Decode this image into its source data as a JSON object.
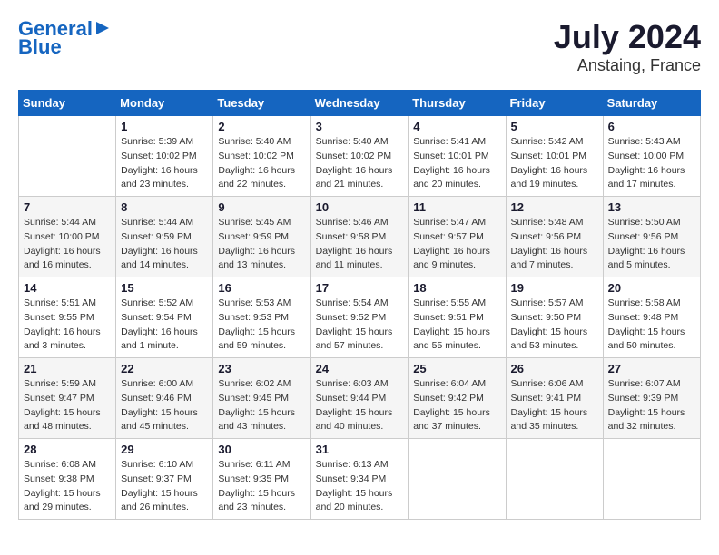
{
  "header": {
    "logo_line1": "General",
    "logo_line2": "Blue",
    "title": "July 2024",
    "subtitle": "Anstaing, France"
  },
  "weekdays": [
    "Sunday",
    "Monday",
    "Tuesday",
    "Wednesday",
    "Thursday",
    "Friday",
    "Saturday"
  ],
  "weeks": [
    [
      {
        "day": "",
        "sunrise": "",
        "sunset": "",
        "daylight": ""
      },
      {
        "day": "1",
        "sunrise": "Sunrise: 5:39 AM",
        "sunset": "Sunset: 10:02 PM",
        "daylight": "Daylight: 16 hours and 23 minutes."
      },
      {
        "day": "2",
        "sunrise": "Sunrise: 5:40 AM",
        "sunset": "Sunset: 10:02 PM",
        "daylight": "Daylight: 16 hours and 22 minutes."
      },
      {
        "day": "3",
        "sunrise": "Sunrise: 5:40 AM",
        "sunset": "Sunset: 10:02 PM",
        "daylight": "Daylight: 16 hours and 21 minutes."
      },
      {
        "day": "4",
        "sunrise": "Sunrise: 5:41 AM",
        "sunset": "Sunset: 10:01 PM",
        "daylight": "Daylight: 16 hours and 20 minutes."
      },
      {
        "day": "5",
        "sunrise": "Sunrise: 5:42 AM",
        "sunset": "Sunset: 10:01 PM",
        "daylight": "Daylight: 16 hours and 19 minutes."
      },
      {
        "day": "6",
        "sunrise": "Sunrise: 5:43 AM",
        "sunset": "Sunset: 10:00 PM",
        "daylight": "Daylight: 16 hours and 17 minutes."
      }
    ],
    [
      {
        "day": "7",
        "sunrise": "Sunrise: 5:44 AM",
        "sunset": "Sunset: 10:00 PM",
        "daylight": "Daylight: 16 hours and 16 minutes."
      },
      {
        "day": "8",
        "sunrise": "Sunrise: 5:44 AM",
        "sunset": "Sunset: 9:59 PM",
        "daylight": "Daylight: 16 hours and 14 minutes."
      },
      {
        "day": "9",
        "sunrise": "Sunrise: 5:45 AM",
        "sunset": "Sunset: 9:59 PM",
        "daylight": "Daylight: 16 hours and 13 minutes."
      },
      {
        "day": "10",
        "sunrise": "Sunrise: 5:46 AM",
        "sunset": "Sunset: 9:58 PM",
        "daylight": "Daylight: 16 hours and 11 minutes."
      },
      {
        "day": "11",
        "sunrise": "Sunrise: 5:47 AM",
        "sunset": "Sunset: 9:57 PM",
        "daylight": "Daylight: 16 hours and 9 minutes."
      },
      {
        "day": "12",
        "sunrise": "Sunrise: 5:48 AM",
        "sunset": "Sunset: 9:56 PM",
        "daylight": "Daylight: 16 hours and 7 minutes."
      },
      {
        "day": "13",
        "sunrise": "Sunrise: 5:50 AM",
        "sunset": "Sunset: 9:56 PM",
        "daylight": "Daylight: 16 hours and 5 minutes."
      }
    ],
    [
      {
        "day": "14",
        "sunrise": "Sunrise: 5:51 AM",
        "sunset": "Sunset: 9:55 PM",
        "daylight": "Daylight: 16 hours and 3 minutes."
      },
      {
        "day": "15",
        "sunrise": "Sunrise: 5:52 AM",
        "sunset": "Sunset: 9:54 PM",
        "daylight": "Daylight: 16 hours and 1 minute."
      },
      {
        "day": "16",
        "sunrise": "Sunrise: 5:53 AM",
        "sunset": "Sunset: 9:53 PM",
        "daylight": "Daylight: 15 hours and 59 minutes."
      },
      {
        "day": "17",
        "sunrise": "Sunrise: 5:54 AM",
        "sunset": "Sunset: 9:52 PM",
        "daylight": "Daylight: 15 hours and 57 minutes."
      },
      {
        "day": "18",
        "sunrise": "Sunrise: 5:55 AM",
        "sunset": "Sunset: 9:51 PM",
        "daylight": "Daylight: 15 hours and 55 minutes."
      },
      {
        "day": "19",
        "sunrise": "Sunrise: 5:57 AM",
        "sunset": "Sunset: 9:50 PM",
        "daylight": "Daylight: 15 hours and 53 minutes."
      },
      {
        "day": "20",
        "sunrise": "Sunrise: 5:58 AM",
        "sunset": "Sunset: 9:48 PM",
        "daylight": "Daylight: 15 hours and 50 minutes."
      }
    ],
    [
      {
        "day": "21",
        "sunrise": "Sunrise: 5:59 AM",
        "sunset": "Sunset: 9:47 PM",
        "daylight": "Daylight: 15 hours and 48 minutes."
      },
      {
        "day": "22",
        "sunrise": "Sunrise: 6:00 AM",
        "sunset": "Sunset: 9:46 PM",
        "daylight": "Daylight: 15 hours and 45 minutes."
      },
      {
        "day": "23",
        "sunrise": "Sunrise: 6:02 AM",
        "sunset": "Sunset: 9:45 PM",
        "daylight": "Daylight: 15 hours and 43 minutes."
      },
      {
        "day": "24",
        "sunrise": "Sunrise: 6:03 AM",
        "sunset": "Sunset: 9:44 PM",
        "daylight": "Daylight: 15 hours and 40 minutes."
      },
      {
        "day": "25",
        "sunrise": "Sunrise: 6:04 AM",
        "sunset": "Sunset: 9:42 PM",
        "daylight": "Daylight: 15 hours and 37 minutes."
      },
      {
        "day": "26",
        "sunrise": "Sunrise: 6:06 AM",
        "sunset": "Sunset: 9:41 PM",
        "daylight": "Daylight: 15 hours and 35 minutes."
      },
      {
        "day": "27",
        "sunrise": "Sunrise: 6:07 AM",
        "sunset": "Sunset: 9:39 PM",
        "daylight": "Daylight: 15 hours and 32 minutes."
      }
    ],
    [
      {
        "day": "28",
        "sunrise": "Sunrise: 6:08 AM",
        "sunset": "Sunset: 9:38 PM",
        "daylight": "Daylight: 15 hours and 29 minutes."
      },
      {
        "day": "29",
        "sunrise": "Sunrise: 6:10 AM",
        "sunset": "Sunset: 9:37 PM",
        "daylight": "Daylight: 15 hours and 26 minutes."
      },
      {
        "day": "30",
        "sunrise": "Sunrise: 6:11 AM",
        "sunset": "Sunset: 9:35 PM",
        "daylight": "Daylight: 15 hours and 23 minutes."
      },
      {
        "day": "31",
        "sunrise": "Sunrise: 6:13 AM",
        "sunset": "Sunset: 9:34 PM",
        "daylight": "Daylight: 15 hours and 20 minutes."
      },
      {
        "day": "",
        "sunrise": "",
        "sunset": "",
        "daylight": ""
      },
      {
        "day": "",
        "sunrise": "",
        "sunset": "",
        "daylight": ""
      },
      {
        "day": "",
        "sunrise": "",
        "sunset": "",
        "daylight": ""
      }
    ]
  ]
}
